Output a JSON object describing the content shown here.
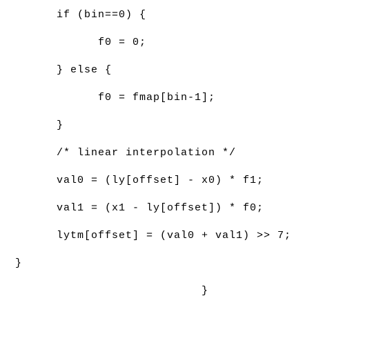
{
  "code": {
    "lines": [
      {
        "text": "if (bin==0) {",
        "indent": "indent-1"
      },
      {
        "text": "f0 = 0;",
        "indent": "indent-2"
      },
      {
        "text": "} else {",
        "indent": "indent-1"
      },
      {
        "text": "f0 = fmap[bin-1];",
        "indent": "indent-2"
      },
      {
        "text": "}",
        "indent": "indent-1"
      },
      {
        "text": "/* linear interpolation */",
        "indent": "indent-1"
      },
      {
        "text": "val0 = (ly[offset] - x0) * f1;",
        "indent": "indent-1"
      },
      {
        "text": "val1 = (x1 - ly[offset]) * f0;",
        "indent": "indent-1"
      },
      {
        "text": "lytm[offset] = (val0 + val1) >> 7;",
        "indent": "indent-1"
      },
      {
        "text": "}",
        "indent": "indent-close"
      },
      {
        "text": "}",
        "indent": "indent-final"
      }
    ]
  }
}
